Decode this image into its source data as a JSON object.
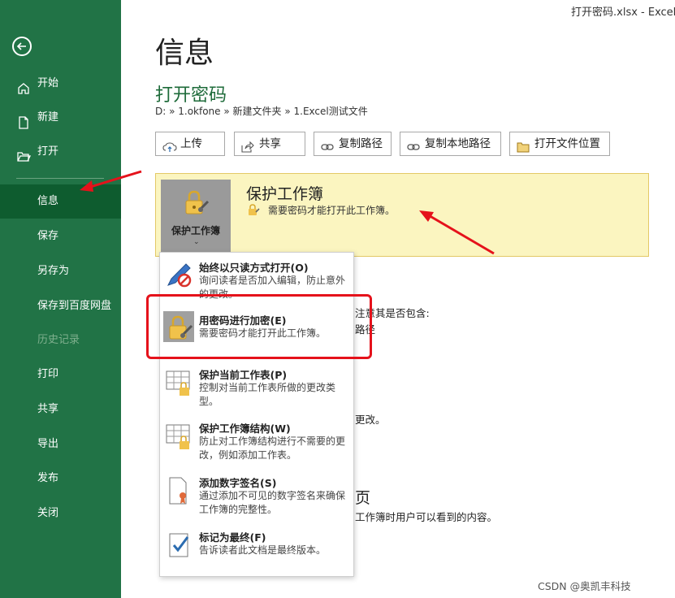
{
  "window": {
    "title": "打开密码.xlsx  -  Excel"
  },
  "sidebar": {
    "items": [
      {
        "label": "开始",
        "icon": "home-icon"
      },
      {
        "label": "新建",
        "icon": "new-document-icon"
      },
      {
        "label": "打开",
        "icon": "open-folder-icon"
      },
      {
        "label": "信息",
        "active": true
      },
      {
        "label": "保存"
      },
      {
        "label": "另存为"
      },
      {
        "label": "保存到百度网盘"
      },
      {
        "label": "历史记录",
        "disabled": true
      },
      {
        "label": "打印"
      },
      {
        "label": "共享"
      },
      {
        "label": "导出"
      },
      {
        "label": "发布"
      },
      {
        "label": "关闭"
      }
    ]
  },
  "main": {
    "page_title": "信息",
    "file_name": "打开密码",
    "breadcrumb": "D: » 1.okfone » 新建文件夹 » 1.Excel测试文件",
    "toolbar": [
      {
        "label": "上传",
        "icon": "upload-icon"
      },
      {
        "label": "共享",
        "icon": "share-icon"
      },
      {
        "label": "复制路径",
        "icon": "link-icon"
      },
      {
        "label": "复制本地路径",
        "icon": "link-icon"
      },
      {
        "label": "打开文件位置",
        "icon": "folder-icon"
      }
    ],
    "protect": {
      "button_label": "保护工作簿",
      "title": "保护工作簿",
      "description": "需要密码才能打开此工作簿。"
    },
    "dropdown": [
      {
        "title": "始终以只读方式打开(O)",
        "description": "询问读者是否加入编辑，防止意外的更改。",
        "icon": "pencil-no-icon"
      },
      {
        "title": "用密码进行加密(E)",
        "description": "需要密码才能打开此工作簿。",
        "icon": "lock-key-icon",
        "highlight": true
      },
      {
        "title": "保护当前工作表(P)",
        "description": "控制对当前工作表所做的更改类型。",
        "icon": "sheet-lock-icon"
      },
      {
        "title": "保护工作簿结构(W)",
        "description": "防止对工作簿结构进行不需要的更改，例如添加工作表。",
        "icon": "workbook-lock-icon"
      },
      {
        "title": "添加数字签名(S)",
        "description": "通过添加不可见的数字签名来确保工作簿的完整性。",
        "icon": "signature-icon"
      },
      {
        "title": "标记为最终(F)",
        "description": "告诉读者此文档是最终版本。",
        "icon": "final-check-icon"
      }
    ],
    "background_fragments": {
      "line1": "注意其是否包含:",
      "line2": "路径",
      "line3": "更改。",
      "line4": "页",
      "line5": "工作簿时用户可以看到的内容。"
    }
  },
  "watermark": "CSDN @奥凯丰科技",
  "colors": {
    "sidebar": "#217346",
    "active": "#0e5c2f",
    "panel": "#fbf5c0",
    "annotation": "#e5121b"
  }
}
